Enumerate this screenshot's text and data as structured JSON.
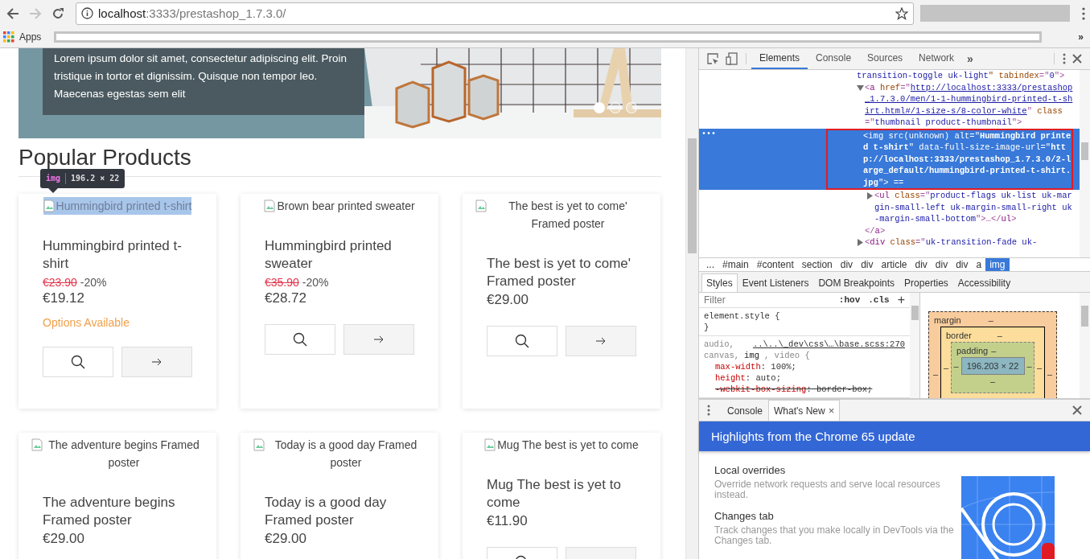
{
  "browser": {
    "url_host": "localhost",
    "url_path": ":3333/prestashop_1.7.3.0/",
    "forward_disabled": true,
    "bookmarks_label": "Apps",
    "more_bookmarks": "»"
  },
  "page": {
    "banner": {
      "text": "Lorem ipsum dolor sit amet, consectetur adipiscing elit. Proin tristique in tortor et dignissim. Quisque non tempor leo. Maecenas egestas sem elit",
      "dots": [
        {
          "selected": true
        },
        {
          "selected": false
        },
        {
          "selected": false
        }
      ]
    },
    "heading": "Popular Products",
    "inspect_tooltip": {
      "tag": "img",
      "size": "196.2 × 22"
    },
    "products": [
      {
        "image_alt": "Hummingbird printed t-shirt",
        "image_highlighted": true,
        "name": "Hummingbird printed t-shirt",
        "old_price": "€23.90",
        "discount": "-20%",
        "price": "€19.12",
        "note": "Options Available",
        "has_buttons": true
      },
      {
        "image_alt": "Brown bear printed sweater",
        "image_highlighted": false,
        "name": "Hummingbird printed sweater",
        "old_price": "€35.90",
        "discount": "-20%",
        "price": "€28.72",
        "has_buttons": true
      },
      {
        "image_alt": "The best is yet to come' Framed poster",
        "image_highlighted": false,
        "name": "The best is yet to come' Framed poster",
        "price": "€29.00",
        "has_buttons": true
      },
      {
        "image_alt": "The adventure begins Framed poster",
        "image_highlighted": false,
        "name": "The adventure begins Framed poster",
        "price": "€29.00"
      },
      {
        "image_alt": "Today is a good day Framed poster",
        "image_highlighted": false,
        "name": "Today is a good day Framed poster",
        "price": "€29.00"
      },
      {
        "image_alt": "Mug The best is yet to come",
        "image_highlighted": false,
        "name": "Mug The best is yet to come",
        "price": "€11.90",
        "has_buttons": true
      }
    ]
  },
  "devtools": {
    "tabs": [
      {
        "label": "Elements",
        "selected": true
      },
      {
        "label": "Console",
        "selected": false
      },
      {
        "label": "Sources",
        "selected": false
      },
      {
        "label": "Network",
        "selected": false
      }
    ],
    "more_tabs": "»",
    "dom_tree": {
      "row_actions": "•••",
      "fragment": [
        {
          "kind": "val",
          "text": "transition-toggle uk-light"
        },
        {
          "kind": "attr",
          "text": "\" tabindex"
        },
        {
          "kind": "p",
          "text": "=\""
        },
        {
          "kind": "val",
          "text": "0"
        },
        {
          "kind": "p",
          "text": "\">"
        }
      ],
      "nodes": [
        {
          "expanded": true,
          "selected": false,
          "segments": [
            {
              "kind": "p",
              "text": "<"
            },
            {
              "kind": "tag",
              "text": "a"
            },
            {
              "kind": "attr",
              "text": " href"
            },
            {
              "kind": "p",
              "text": "=\""
            },
            {
              "kind": "link",
              "text": "http://localhost:3333/prestashop_1.7.3.0/men/1-1-hummingbird-printed-t-shirt.html#/1-size-s/8-color-white"
            },
            {
              "kind": "p",
              "text": "\""
            },
            {
              "kind": "attr",
              "text": " class"
            },
            {
              "kind": "p",
              "text": "=\""
            },
            {
              "kind": "val",
              "text": "thumbnail product-thumbnail"
            },
            {
              "kind": "p",
              "text": "\">"
            }
          ],
          "children": [
            {
              "selected": true,
              "segments": [
                {
                  "kind": "p",
                  "text": "<"
                },
                {
                  "kind": "tag",
                  "text": "img"
                },
                {
                  "kind": "attr",
                  "text": " src(unknown) alt"
                },
                {
                  "kind": "p",
                  "text": "=\""
                },
                {
                  "kind": "val",
                  "text": "Hummingbird printed t-shirt"
                },
                {
                  "kind": "p",
                  "text": "\""
                },
                {
                  "kind": "attr",
                  "text": " data-full-size-image-url"
                },
                {
                  "kind": "p",
                  "text": "=\""
                },
                {
                  "kind": "val",
                  "text": "http://localhost:3333/prestashop_1.7.3.0/2-large_default/hummingbird-printed-t-shirt.jpg"
                },
                {
                  "kind": "p",
                  "text": "\"> =="
                }
              ]
            },
            {
              "expanded": false,
              "selected": false,
              "segments": [
                {
                  "kind": "p",
                  "text": "<"
                },
                {
                  "kind": "tag",
                  "text": "ul"
                },
                {
                  "kind": "attr",
                  "text": " class"
                },
                {
                  "kind": "p",
                  "text": "=\""
                },
                {
                  "kind": "val",
                  "text": "product-flags uk-list uk-margin-small-left uk-margin-small-right uk-margin-small-bottom"
                },
                {
                  "kind": "p",
                  "text": "\">…</"
                },
                {
                  "kind": "tag",
                  "text": "ul"
                },
                {
                  "kind": "p",
                  "text": ">"
                }
              ]
            }
          ],
          "close": [
            {
              "kind": "p",
              "text": "</"
            },
            {
              "kind": "tag",
              "text": "a"
            },
            {
              "kind": "p",
              "text": ">"
            }
          ]
        },
        {
          "expanded": false,
          "selected": false,
          "segments": [
            {
              "kind": "p",
              "text": "<"
            },
            {
              "kind": "tag",
              "text": "div"
            },
            {
              "kind": "attr",
              "text": " class"
            },
            {
              "kind": "p",
              "text": "=\""
            },
            {
              "kind": "val",
              "text": "uk-transition-fade uk-"
            }
          ]
        }
      ]
    },
    "breadcrumbs": [
      {
        "label": "...",
        "selected": false
      },
      {
        "label": "#main",
        "selected": false
      },
      {
        "label": "#content",
        "selected": false
      },
      {
        "label": "section",
        "selected": false
      },
      {
        "label": "div",
        "selected": false
      },
      {
        "label": "div",
        "selected": false
      },
      {
        "label": "article",
        "selected": false
      },
      {
        "label": "div",
        "selected": false
      },
      {
        "label": "div",
        "selected": false
      },
      {
        "label": "div",
        "selected": false
      },
      {
        "label": "a",
        "selected": false
      },
      {
        "label": "img",
        "selected": true
      }
    ],
    "style_tabs": [
      {
        "label": "Styles",
        "selected": true
      },
      {
        "label": "Event Listeners",
        "selected": false
      },
      {
        "label": "DOM Breakpoints",
        "selected": false
      },
      {
        "label": "Properties",
        "selected": false
      },
      {
        "label": "Accessibility",
        "selected": false
      }
    ],
    "filter": {
      "placeholder": "Filter",
      "hov": ":hov",
      "cls": ".cls",
      "add": "+"
    },
    "rules": [
      {
        "selector": "element.style {",
        "close": "}"
      },
      {
        "source": "..\\..\\_dev\\css\\…\\base.scss:270",
        "selector_parts": [
          {
            "text": "audio,",
            "matched": false
          }
        ],
        "selector_line": [
          {
            "text": "canvas,",
            "matched": false
          },
          {
            "text": "img",
            "matched": true
          },
          {
            "text": ", video {",
            "matched": false
          }
        ],
        "props": [
          {
            "name": "max-width",
            "separator": ":",
            "value": "100%;",
            "overridden": false
          },
          {
            "name": "height",
            "separator": ":",
            "value": "auto;",
            "overridden": false
          },
          {
            "name": "-webkit-box-sizing",
            "separator": ":",
            "value": "border-box;",
            "overridden": true
          }
        ]
      }
    ],
    "box_model": {
      "margin_label": "margin",
      "margin": "–",
      "border_label": "border",
      "border": "–",
      "padding_label": "padding",
      "padding": "–",
      "content": "196.203 × 22",
      "sides": [
        "–",
        "–",
        "–",
        "–",
        "–",
        "–"
      ],
      "padding_bottom": "–"
    },
    "drawer": {
      "tabs": [
        {
          "label": "Console",
          "selected": false,
          "closable": false
        },
        {
          "label": "What's New",
          "selected": true,
          "closable": true
        }
      ],
      "close_tab": "×",
      "banner": "Highlights from the Chrome 65 update",
      "items": [
        {
          "title": "Local overrides",
          "description": "Override network requests and serve local resources instead."
        },
        {
          "title": "Changes tab",
          "description": "Track changes that you make locally in DevTools via the Changes tab."
        }
      ]
    }
  }
}
